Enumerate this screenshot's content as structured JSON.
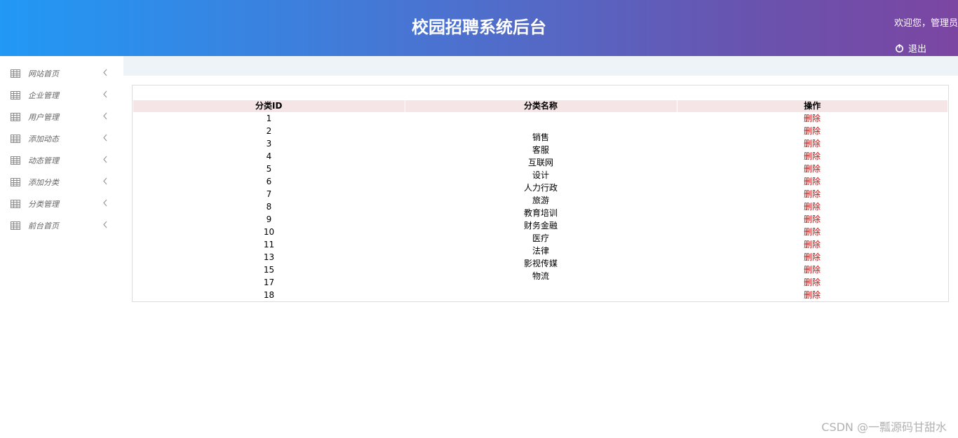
{
  "header": {
    "title": "校园招聘系统后台",
    "welcome": "欢迎您，管理员",
    "logout_label": "退出"
  },
  "sidebar": {
    "items": [
      {
        "label": "网站首页",
        "icon": "grid-icon"
      },
      {
        "label": "企业管理",
        "icon": "grid-icon"
      },
      {
        "label": "用户管理",
        "icon": "grid-icon"
      },
      {
        "label": "添加动态",
        "icon": "grid-icon"
      },
      {
        "label": "动态管理",
        "icon": "grid-icon"
      },
      {
        "label": "添加分类",
        "icon": "grid-icon"
      },
      {
        "label": "分类管理",
        "icon": "grid-icon"
      },
      {
        "label": "前台首页",
        "icon": "grid-icon"
      }
    ]
  },
  "table": {
    "columns": [
      "分类ID",
      "分类名称",
      "操作"
    ],
    "rows": [
      {
        "id": "1",
        "name": "",
        "action": "删除"
      },
      {
        "id": "2",
        "name": "销售",
        "action": "删除"
      },
      {
        "id": "3",
        "name": "客服",
        "action": "删除"
      },
      {
        "id": "4",
        "name": "互联网",
        "action": "删除"
      },
      {
        "id": "5",
        "name": "设计",
        "action": "删除"
      },
      {
        "id": "6",
        "name": "人力行政",
        "action": "删除"
      },
      {
        "id": "7",
        "name": "旅游",
        "action": "删除"
      },
      {
        "id": "8",
        "name": "教育培训",
        "action": "删除"
      },
      {
        "id": "9",
        "name": "财务金融",
        "action": "删除"
      },
      {
        "id": "10",
        "name": "医疗",
        "action": "删除"
      },
      {
        "id": "11",
        "name": "法律",
        "action": "删除"
      },
      {
        "id": "13",
        "name": "影视传媒",
        "action": "删除"
      },
      {
        "id": "15",
        "name": "物流",
        "action": "删除"
      },
      {
        "id": "17",
        "name": "",
        "action": "删除"
      },
      {
        "id": "18",
        "name": "",
        "action": "删除"
      }
    ]
  },
  "watermark": "CSDN @一瓢源码甘甜水",
  "colors": {
    "header_start": "#2199f5",
    "header_end": "#7b46a2",
    "table_header_bg": "#f6e5e6",
    "delete_link": "#d60000"
  }
}
